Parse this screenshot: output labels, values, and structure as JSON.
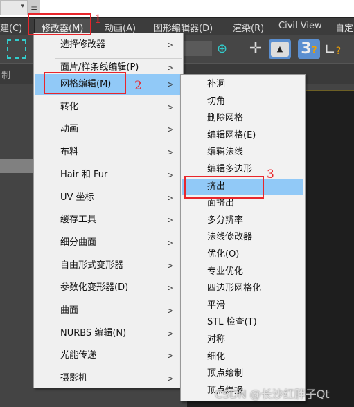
{
  "menubar": {
    "items": [
      "建(C)",
      "修改器(M)",
      "动画(A)",
      "图形编辑器(D)",
      "渲染(R)",
      "Civil View",
      "自定"
    ]
  },
  "panel": {
    "label": "制"
  },
  "menu": {
    "items": [
      {
        "label": "选择修改器"
      },
      {
        "label": "面片/样条线编辑(P)"
      },
      {
        "label": "网格编辑(M)",
        "highlighted": true
      },
      {
        "label": "转化"
      },
      {
        "label": "动画"
      },
      {
        "label": "布料"
      },
      {
        "label": "Hair 和 Fur"
      },
      {
        "label": "UV 坐标"
      },
      {
        "label": "缓存工具"
      },
      {
        "label": "细分曲面"
      },
      {
        "label": "自由形式变形器"
      },
      {
        "label": "参数化变形器(D)"
      },
      {
        "label": "曲面"
      },
      {
        "label": "NURBS 编辑(N)"
      },
      {
        "label": "光能传递"
      },
      {
        "label": "摄影机"
      }
    ]
  },
  "submenu": {
    "items": [
      "补洞",
      "切角",
      "删除网格",
      "编辑网格(E)",
      "编辑法线",
      "编辑多边形",
      "挤出",
      "面挤出",
      "多分辨率",
      "法线修改器",
      "优化(O)",
      "专业优化",
      "四边形网格化",
      "平滑",
      "STL 检查(T)",
      "对称",
      "细化",
      "顶点绘制",
      "顶点焊接"
    ],
    "highlighted": "挤出"
  },
  "annotations": [
    "1",
    "2",
    "3"
  ],
  "watermark": "CSDN @长沙红胖子Qt",
  "colors": {
    "highlight": "#91c9f7",
    "annotation": "#e8262c",
    "toolbar_active": "#5b8fd0"
  }
}
